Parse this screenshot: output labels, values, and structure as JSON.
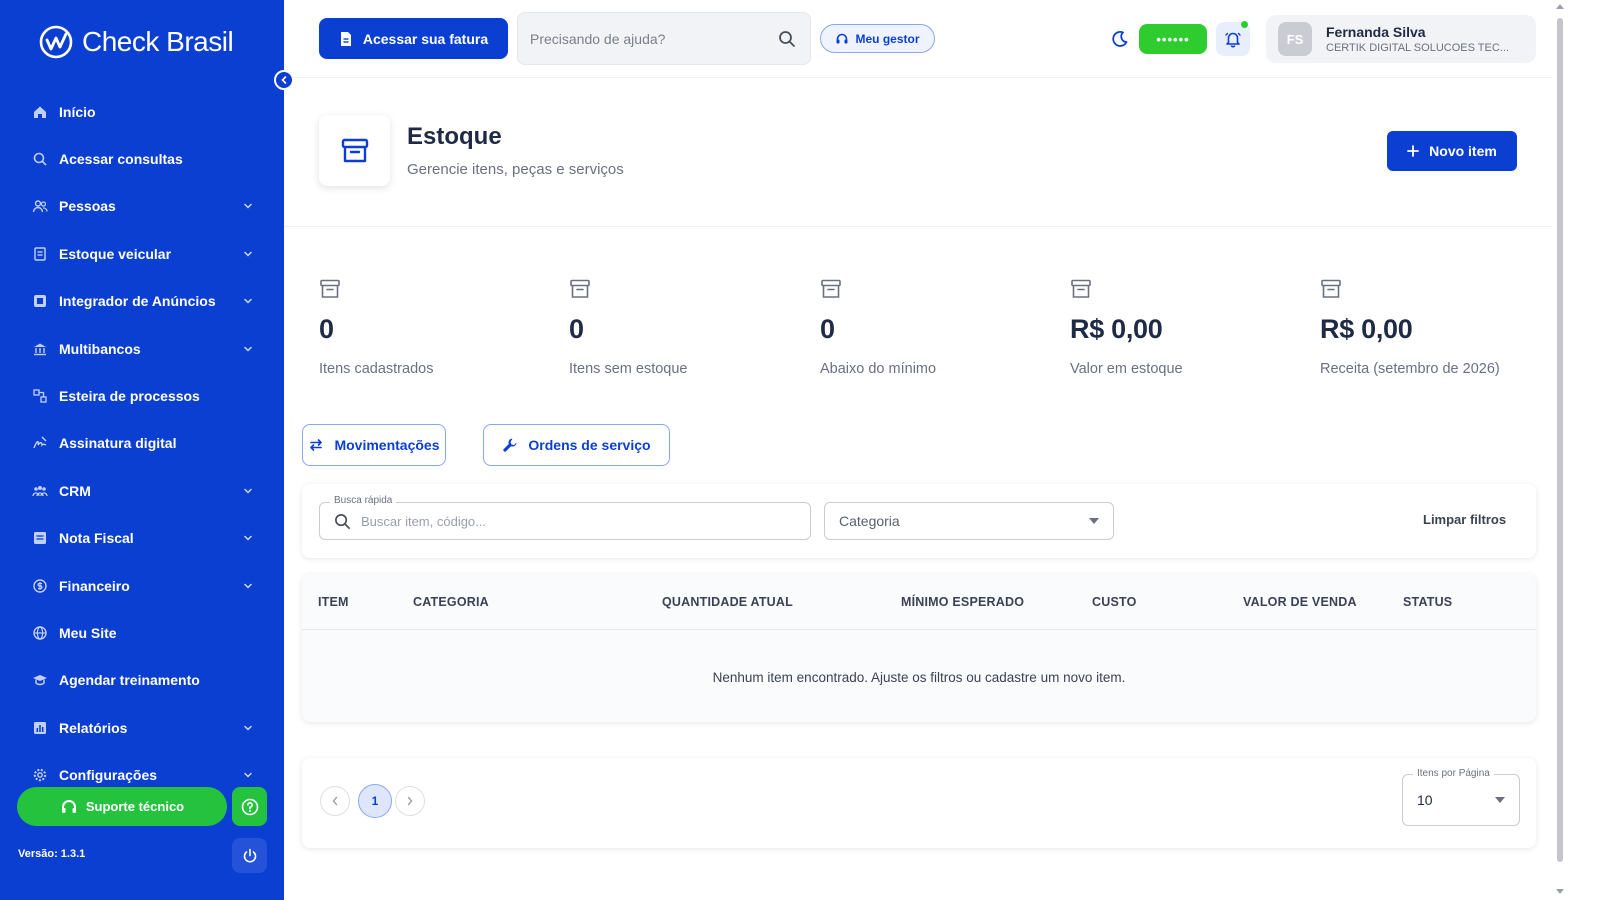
{
  "brand": {
    "name": "Check Brasil"
  },
  "sidebar": {
    "items": [
      {
        "label": "Início",
        "icon": "home-icon",
        "chevron": false
      },
      {
        "label": "Acessar consultas",
        "icon": "search-icon",
        "chevron": false
      },
      {
        "label": "Pessoas",
        "icon": "people-icon",
        "chevron": true
      },
      {
        "label": "Estoque veicular",
        "icon": "car-stock-icon",
        "chevron": true
      },
      {
        "label": "Integrador de Anúncios",
        "icon": "ads-icon",
        "chevron": true
      },
      {
        "label": "Multibancos",
        "icon": "bank-icon",
        "chevron": true
      },
      {
        "label": "Esteira de processos",
        "icon": "process-icon",
        "chevron": false
      },
      {
        "label": "Assinatura digital",
        "icon": "signature-icon",
        "chevron": false
      },
      {
        "label": "CRM",
        "icon": "crm-icon",
        "chevron": true
      },
      {
        "label": "Nota Fiscal",
        "icon": "invoice-icon",
        "chevron": true
      },
      {
        "label": "Financeiro",
        "icon": "finance-icon",
        "chevron": true
      },
      {
        "label": "Meu Site",
        "icon": "globe-icon",
        "chevron": false
      },
      {
        "label": "Agendar treinamento",
        "icon": "training-icon",
        "chevron": false
      },
      {
        "label": "Relatórios",
        "icon": "report-icon",
        "chevron": true
      },
      {
        "label": "Configurações",
        "icon": "gear-icon",
        "chevron": true
      }
    ],
    "support_label": "Suporte técnico",
    "version": "Versão: 1.3.1"
  },
  "header": {
    "invoice_label": "Acessar sua fatura",
    "help_placeholder": "Precisando de ajuda?",
    "manager_label": "Meu gestor",
    "status_text": "••••••",
    "user": {
      "initials": "FS",
      "name": "Fernanda Silva",
      "company": "CERTIK DIGITAL SOLUCOES TEC..."
    }
  },
  "page": {
    "title": "Estoque",
    "subtitle": "Gerencie itens, peças e serviços",
    "new_item_label": "Novo item"
  },
  "stats": [
    {
      "value": "0",
      "label": "Itens cadastrados"
    },
    {
      "value": "0",
      "label": "Itens sem estoque"
    },
    {
      "value": "0",
      "label": "Abaixo do mínimo"
    },
    {
      "value": "R$ 0,00",
      "label": "Valor em estoque"
    },
    {
      "value": "R$ 0,00",
      "label": "Receita (setembro de 2026)"
    }
  ],
  "actions": {
    "movements_label": "Movimentações",
    "orders_label": "Ordens de serviço"
  },
  "filters": {
    "quick_label": "Busca rápida",
    "quick_placeholder": "Buscar item, código...",
    "category_value": "Categoria",
    "clear_label": "Limpar filtros"
  },
  "table": {
    "headers": [
      "ITEM",
      "CATEGORIA",
      "QUANTIDADE ATUAL",
      "MÍNIMO ESPERADO",
      "CUSTO",
      "VALOR DE VENDA",
      "STATUS"
    ],
    "empty_message": "Nenhum item encontrado. Ajuste os filtros ou cadastre um novo item."
  },
  "pagination": {
    "current_page": "1",
    "per_page_label": "Itens por Página",
    "per_page_value": "10"
  },
  "colors": {
    "primary": "#0b3fd1",
    "success": "#25c33d",
    "text": "#1f2a44",
    "muted": "#6b7080"
  }
}
